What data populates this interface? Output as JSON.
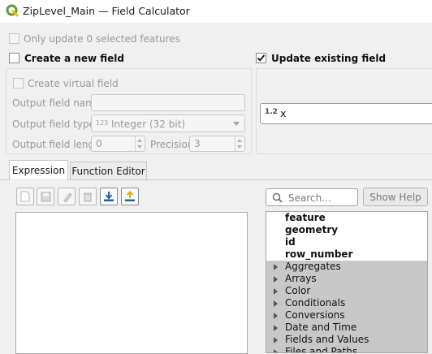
{
  "window": {
    "title": "ZipLevel_Main — Field Calculator"
  },
  "top": {
    "only_selected_label": "Only update 0 selected features"
  },
  "create": {
    "label": "Create a new field",
    "virtual_label": "Create virtual field",
    "name_label": "Output field name",
    "name_value": "",
    "type_label": "Output field type",
    "type_badge": "123",
    "type_value": "Integer (32 bit)",
    "length_label": "Output field length",
    "length_value": "0",
    "precision_label": "Precision",
    "precision_value": "3"
  },
  "update": {
    "label": "Update existing field",
    "checked": true,
    "field_badge": "1.2",
    "field_value": "x"
  },
  "tabs": [
    {
      "label": "Expression",
      "active": true
    },
    {
      "label": "Function Editor",
      "active": false
    }
  ],
  "toolbar": {
    "icons": [
      "new-file-icon",
      "save-icon",
      "edit-icon",
      "delete-icon",
      "import-icon",
      "export-icon"
    ]
  },
  "search": {
    "placeholder": "Search..."
  },
  "help": {
    "label": "Show Help"
  },
  "functions": [
    {
      "label": "feature",
      "kind": "item"
    },
    {
      "label": "geometry",
      "kind": "item"
    },
    {
      "label": "id",
      "kind": "item"
    },
    {
      "label": "row_number",
      "kind": "item"
    },
    {
      "label": "Aggregates",
      "kind": "group"
    },
    {
      "label": "Arrays",
      "kind": "group"
    },
    {
      "label": "Color",
      "kind": "group"
    },
    {
      "label": "Conditionals",
      "kind": "group"
    },
    {
      "label": "Conversions",
      "kind": "group"
    },
    {
      "label": "Date and Time",
      "kind": "group"
    },
    {
      "label": "Fields and Values",
      "kind": "group"
    },
    {
      "label": "Files and Paths",
      "kind": "group"
    }
  ],
  "colors": {
    "qgis_green": "#5a9e2f",
    "group_bg": "#c8c8c8",
    "accent_blue": "#1f5fa8",
    "accent_yellow": "#e0b000"
  }
}
